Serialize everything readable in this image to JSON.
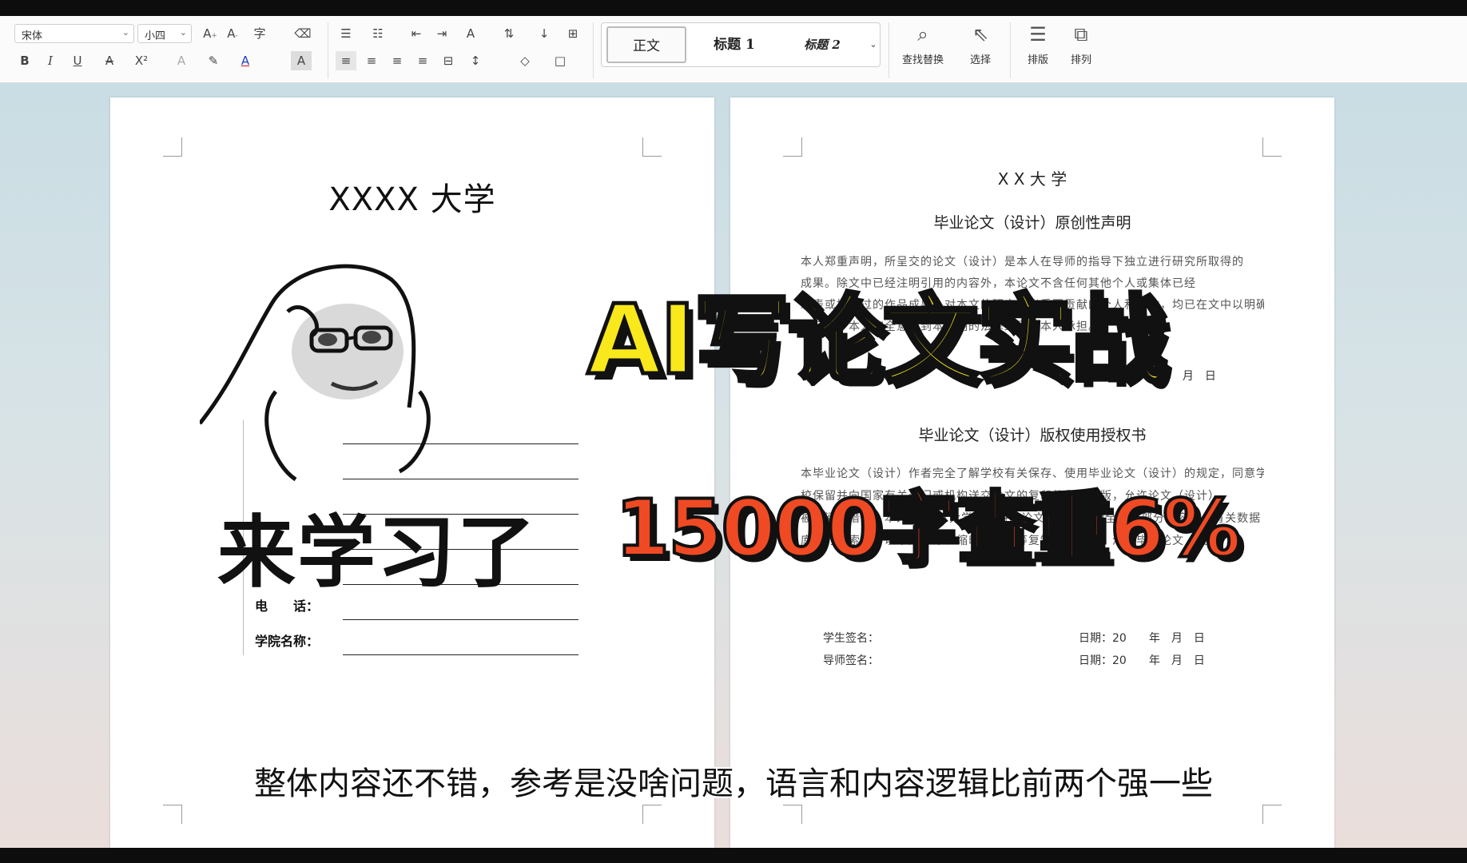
{
  "ribbon": {
    "font_name": "宋体",
    "font_size": "小四",
    "styles": [
      "正文",
      "标题 1",
      "标题 2"
    ],
    "find_replace": "查找替换",
    "select": "选择",
    "layout": "排版",
    "arrange": "排列"
  },
  "left_page": {
    "title": "XXXX 大学",
    "rows": [
      {
        "label": "电　　话："
      },
      {
        "label": "学院名称："
      }
    ]
  },
  "right_page": {
    "univ": "X X 大 学",
    "decl_title": "毕业论文（设计）原创性声明",
    "decl_lines": [
      "本人郑重声明，所呈交的论文（设计）是本人在导师的指导下独立进行研究所取得的",
      "成果。除文中已经注明引用的内容外，本论文不含任何其他个人或集体已经",
      "发表或撰写过的作品成果。对本文的研究做出重要贡献的个人和集体，均已在文中以明确方",
      "式标明。本人完全意识到本声明的法律结果由本人承担。"
    ],
    "student_sig_1": "学生签名：",
    "date_1": "日期：20　　年　月　日",
    "auth_title": "毕业论文（设计）版权使用授权书",
    "auth_lines": [
      "本毕业论文（设计）作者完全了解学校有关保存、使用毕业论文（设计）的规定，同意学",
      "校保留并向国家有关部门或机构送交论文的复印件和电子版，允许论文（设计）",
      "被查阅和借阅。本人授权XX大学可以将本论文（设计）的全部或部分内容编入有关数据",
      "库进行检索，可以采用影印、缩印或扫描等复制手段保存、汇编毕业论文（设计）。"
    ],
    "student_sig_2": "学生签名：",
    "date_2": "日期：20　　年　月　日",
    "teacher_sig": "导师签名：",
    "date_3": "日期：20　　年　月　日"
  },
  "overlay": {
    "meme_caption": "来学习了",
    "title": "AI写论文实战",
    "subtitle_stat": "15000字查重6%",
    "caption": "整体内容还不错，参考是没啥问题，语言和内容逻辑比前两个强一些"
  },
  "colors": {
    "title_yellow": "#f8e81c",
    "stat_orange": "#ef4a24"
  }
}
